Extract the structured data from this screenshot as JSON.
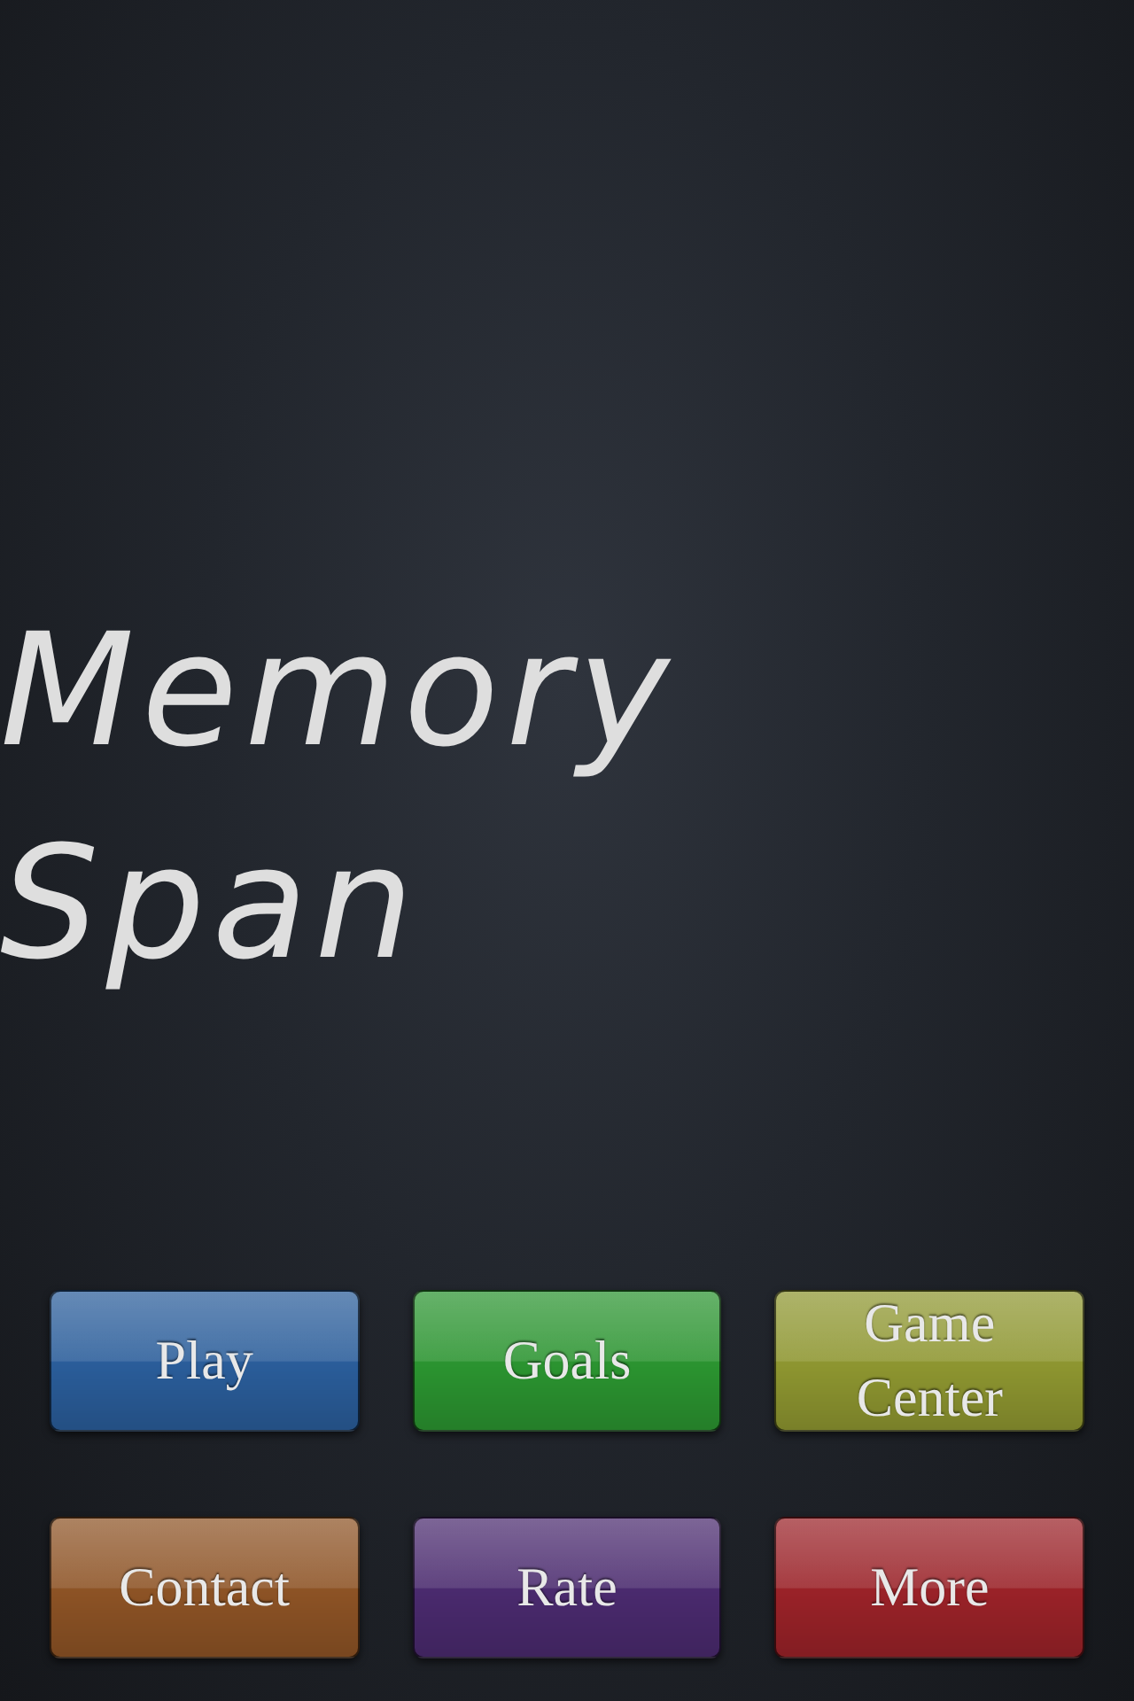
{
  "title": "Memory Span",
  "buttons": [
    {
      "label": "Play",
      "color": "#2a5d9a"
    },
    {
      "label": "Goals",
      "color": "#2b9430"
    },
    {
      "label": "Game Center",
      "color": "#8e9630"
    },
    {
      "label": "Contact",
      "color": "#8d5325"
    },
    {
      "label": "Rate",
      "color": "#4a2a6e"
    },
    {
      "label": "More",
      "color": "#9a2228"
    }
  ]
}
